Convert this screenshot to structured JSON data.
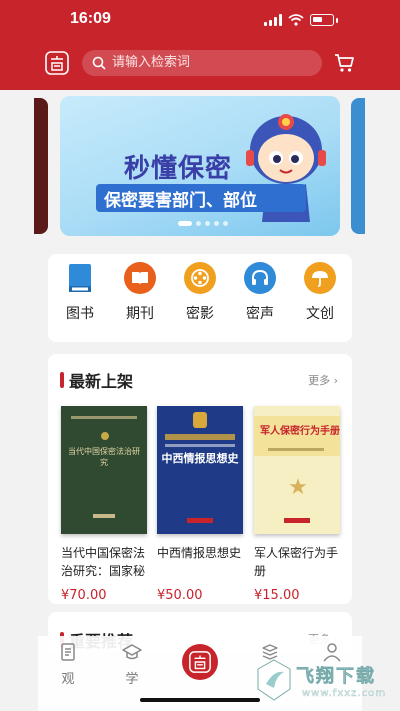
{
  "status": {
    "time": "16:09"
  },
  "header": {
    "logo_icon": "seal-logo-icon",
    "search": {
      "placeholder": "请输入检索词"
    },
    "cart_icon": "cart-icon",
    "brand_color": "#c8242c"
  },
  "banner": {
    "title": "秒懂保密",
    "subtitle": "保密要害部门、部位",
    "slide_count": 5,
    "active_slide": 0
  },
  "categories": [
    {
      "label": "图书",
      "icon": "book-icon",
      "color": "#2f8ad8"
    },
    {
      "label": "期刊",
      "icon": "journal-icon",
      "color": "#e8601c"
    },
    {
      "label": "密影",
      "icon": "film-icon",
      "color": "#f0a01e"
    },
    {
      "label": "密声",
      "icon": "headphones-icon",
      "color": "#2f8ad8"
    },
    {
      "label": "文创",
      "icon": "umbrella-icon",
      "color": "#f0a01e"
    }
  ],
  "latest": {
    "title": "最新上架",
    "more": "更多 ›",
    "books": [
      {
        "title": "当代中国保密法治研究：国家秘密...",
        "price": "¥70.00",
        "cover_text": "当代中国保密法治研究"
      },
      {
        "title": "中西情报思想史",
        "price": "¥50.00",
        "cover_text": "中西情报思想史"
      },
      {
        "title": "军人保密行为手册",
        "price": "¥15.00",
        "cover_text": "军人保密行为手册"
      }
    ]
  },
  "recommend": {
    "title": "重要推荐",
    "more": "更多 ›"
  },
  "tabbar": {
    "items": [
      {
        "label": "观",
        "icon": "document-icon"
      },
      {
        "label": "学",
        "icon": "graduation-cap-icon"
      },
      {
        "label": "",
        "icon": "seal-logo-icon"
      },
      {
        "label": "",
        "icon": "bookshelf-icon"
      },
      {
        "label": "",
        "icon": "user-icon"
      }
    ]
  },
  "watermark": {
    "text": "飞翔下载",
    "url": "www.fxxz.com"
  }
}
